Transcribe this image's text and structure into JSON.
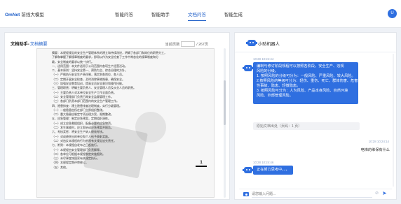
{
  "brand": {
    "name_en": "OmNet",
    "name_cn": "前线大模型"
  },
  "nav": {
    "items": [
      "智能问答",
      "智能助手",
      "文档问答",
      "智能生成"
    ],
    "active_index": 2
  },
  "user": {
    "avatar_letter": "U"
  },
  "left": {
    "title": "文档助手-",
    "doc_name": "文档摘要",
    "pager": {
      "label_before": "当前页数",
      "label_after": "/ 267页",
      "current": ""
    },
    "page_number": "1",
    "doc_lines": [
      "摘要：本规程规定的安全生产管理体系的建立和持续改进，明确了各部门和岗位的职责分工，",
      "了解和掌握了解规章制度的要求，即用以作为安全检查了工作中常态化的规章制度和分",
      "级，安全制度的要求以统一执行。",
      "一、适用范围：本文件适用于公司范围内各项生产经营活动。",
      "二、基本原则：坚持安全第一、预防为主、综合治理的方针。",
      "（一）严格执行安全生产责任制，落实到各岗位、各人员。",
      "（二）定期开展安全检查，及时消除事故隐患，确保安全。",
      "（三）加强安全教育培训，提高全员安全意识和操作技能。",
      "三、管理职责：明确主要负责人、安全管理人员及从业人员的职责。",
      "（一）主要负责人对本单位安全生产工作全面负责。",
      "（二）安全管理部门负责日常安全监督管理工作。",
      "（三）各部门负责本部门范围内的安全生产管理工作。",
      "四、隐患排查：建立隐患排查治理制度，实行分级管理。",
      "（一）一般隐患由所在部门立即组织整改。",
      "（二）重大隐患应制定专项治理方案，限期整改。",
      "五、应急管理：制定应急预案，定期组织演练。",
      "（一）成立应急救援组织，配备必要的应急物资。",
      "（二）发生事故时，应立即启动应急预案并报告。",
      "六、考核奖惩：将安全生产纳入绩效考核。",
      "（一）对成绩突出的单位和个人给予表彰奖励。",
      "（二）对违反本规程的行为依照有关规定追究责任。",
      "七、附则：本规程自发布之日起施行。",
      "（一）本规程由安全管理部门负责解释。",
      "（二）各单位可根据本规程制定实施细则。",
      "（三）未尽事宜按国家有关规定执行。",
      "（四）本规程定期评审修订。",
      "（五）其他。"
    ]
  },
  "chat": {
    "title": "小助机器人",
    "messages": [
      {
        "type": "bot",
        "time": "10:28 10:24:44",
        "lines": [
          "编制与修订阶段规程可以按照各阶段，安全生产、违规",
          "风险的分级。",
          "1. 按照风险的分级可分为：一般风险、严重风险、较大风险。",
          "2.按照风险的等级可分为：轻伤、重伤、死亡、群体伤害、危害",
          "性事故、隐患、轻微隐患。",
          "3. 按照风险可分为：人为风险、产品本身风险、自然环境",
          "风险、外部管理风险。"
        ]
      },
      {
        "type": "source",
        "text": "原始文档出处（页码：1 页）"
      },
      {
        "type": "user",
        "time": "10:28 10:24:14",
        "text": "电梯的维保有什么"
      },
      {
        "type": "bot",
        "time": "10:28 10:24:46",
        "lines": [
          "正在努力思考中，，，"
        ]
      }
    ],
    "input_placeholder": "请您输入问题...",
    "send_icon": "send-icon"
  },
  "colors": {
    "accent": "#2f6fe0",
    "brand": "#1f5fc8"
  }
}
